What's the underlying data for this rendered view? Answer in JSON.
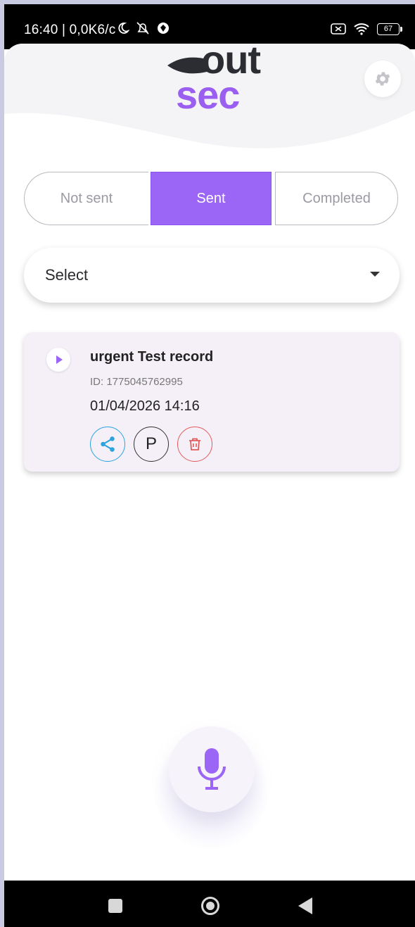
{
  "status_bar": {
    "time_info": "16:40 | 0,0K6/c",
    "battery": "67",
    "icons": [
      "moon-icon",
      "mute-icon",
      "vpn-icon",
      "sim-off-icon",
      "wifi-icon",
      "battery-icon"
    ]
  },
  "logo": {
    "top": "out",
    "bottom": "sec"
  },
  "tabs": [
    {
      "label": "Not sent",
      "selected": false
    },
    {
      "label": "Sent",
      "selected": true
    },
    {
      "label": "Completed",
      "selected": false
    }
  ],
  "select": {
    "label": "Select"
  },
  "records": [
    {
      "title": "urgent Test record",
      "id": "ID: 1775045762995",
      "date": "01/04/2026 14:16",
      "p_label": "P"
    }
  ],
  "colors": {
    "accent": "#9b65f5",
    "share": "#2ba3de",
    "delete": "#e05a5a",
    "card_bg": "#f5f0f8"
  }
}
